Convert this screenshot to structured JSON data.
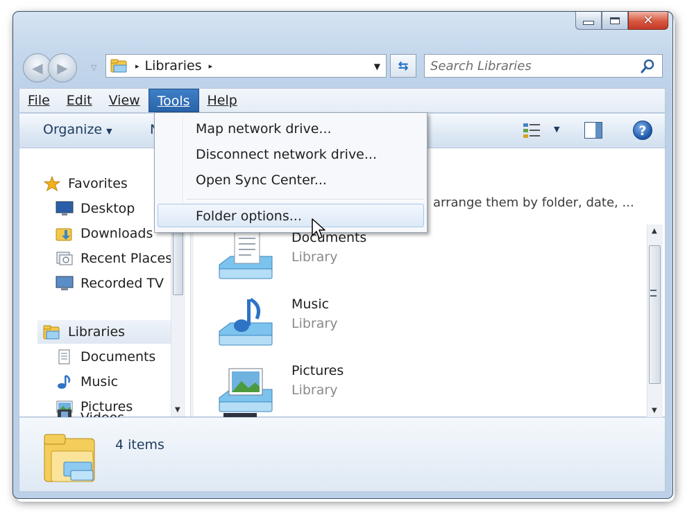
{
  "window": {
    "caption": {
      "minimize": "minimize",
      "maximize": "maximize",
      "close": "close"
    }
  },
  "address_bar": {
    "path": "Libraries",
    "separator": "▸"
  },
  "search": {
    "placeholder": "Search Libraries"
  },
  "menu_bar": {
    "items": [
      {
        "label": "File",
        "underline": "F"
      },
      {
        "label": "Edit",
        "underline": "E"
      },
      {
        "label": "View",
        "underline": "V"
      },
      {
        "label": "Tools",
        "underline": "T",
        "active": true
      },
      {
        "label": "Help",
        "underline": "H"
      }
    ]
  },
  "command_bar": {
    "organize": "Organize",
    "partial_hidden": "N"
  },
  "tools_menu": {
    "items": [
      {
        "label": "Map network drive...",
        "mnemonic": "n"
      },
      {
        "label": "Disconnect network drive...",
        "mnemonic": "D"
      },
      {
        "label": "Open Sync Center...",
        "mnemonic": "S"
      },
      {
        "label": "Folder options...",
        "mnemonic": "o",
        "hovered": true
      }
    ]
  },
  "nav_pane": {
    "favorites_label": "Favorites",
    "favorites": [
      "Desktop",
      "Downloads",
      "Recent Places",
      "Recorded TV"
    ],
    "libraries_label": "Libraries",
    "libraries": [
      "Documents",
      "Music",
      "Pictures",
      "Videos"
    ]
  },
  "main": {
    "header_hint": "arrange them by folder, date, ...",
    "libraries": [
      {
        "name": "Documents",
        "type": "Library",
        "icon": "documents-library-icon"
      },
      {
        "name": "Music",
        "type": "Library",
        "icon": "music-library-icon"
      },
      {
        "name": "Pictures",
        "type": "Library",
        "icon": "pictures-library-icon"
      }
    ]
  },
  "details": {
    "count_text": "4 items"
  },
  "colors": {
    "accent": "#2a63a8",
    "window_frame": "#c4d7ec",
    "close_red": "#d7573e"
  }
}
